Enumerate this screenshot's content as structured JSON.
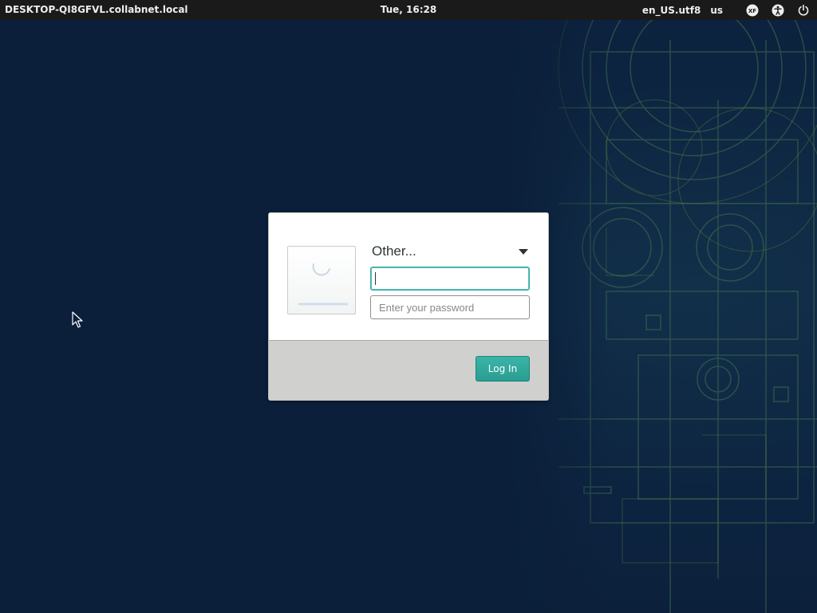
{
  "topbar": {
    "hostname": "DESKTOP-QI8GFVL.collabnet.local",
    "clock": "Tue, 16:28",
    "locale": "en_US.utf8",
    "keyboard_layout": "us",
    "icons": [
      "keyboard-layout-icon",
      "accessibility-icon",
      "power-icon"
    ]
  },
  "login": {
    "user_select_label": "Other...",
    "username_value": "",
    "password_placeholder": "Enter your password",
    "login_label": "Log In",
    "accent_color": "#2aa396"
  },
  "desktop": {
    "background_color": "#0c1f3a"
  }
}
